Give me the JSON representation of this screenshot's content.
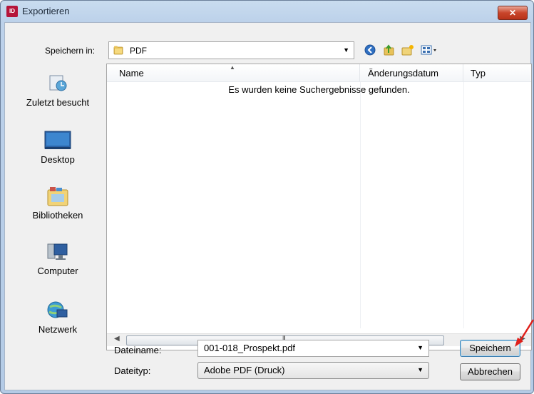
{
  "window": {
    "title": "Exportieren",
    "app_icon_text": "ID",
    "close_symbol": "✕"
  },
  "toolbar": {
    "save_in_label": "Speichern in:",
    "current_folder": "PDF",
    "buttons": [
      "back-icon",
      "up-folder-icon",
      "new-folder-icon",
      "view-menu-icon"
    ]
  },
  "places": [
    {
      "label": "Zuletzt besucht",
      "icon": "recent-places-icon"
    },
    {
      "label": "Desktop",
      "icon": "desktop-icon"
    },
    {
      "label": "Bibliotheken",
      "icon": "libraries-icon"
    },
    {
      "label": "Computer",
      "icon": "computer-icon"
    },
    {
      "label": "Netzwerk",
      "icon": "network-icon"
    }
  ],
  "list": {
    "columns": [
      "Name",
      "Änderungsdatum",
      "Typ"
    ],
    "empty_message": "Es wurden keine Suchergebnisse gefunden.",
    "scroll_grip": "III"
  },
  "form": {
    "filename_label": "Dateiname:",
    "filename_value": "001-018_Prospekt.pdf",
    "filetype_label": "Dateityp:",
    "filetype_value": "Adobe PDF (Druck)"
  },
  "buttons": {
    "save": "Speichern",
    "cancel": "Abbrechen"
  },
  "colors": {
    "annotation_arrow": "#e0201b",
    "title_gradient": "#bcd1ea",
    "close_button": "#c9452b"
  }
}
